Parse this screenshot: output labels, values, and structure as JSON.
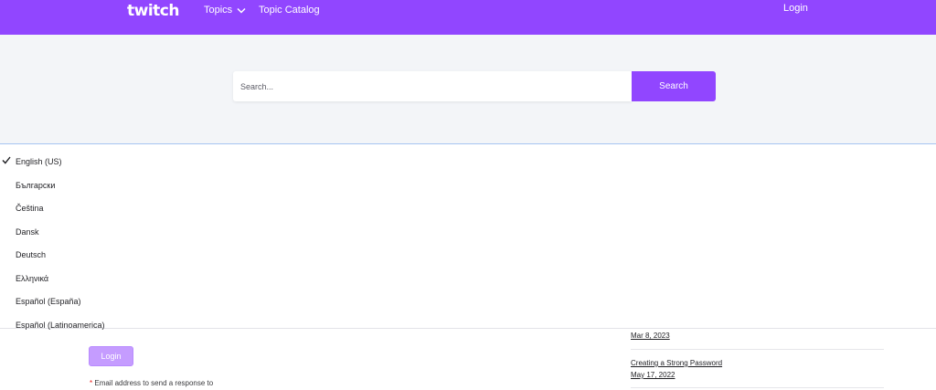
{
  "header": {
    "logo_text": "twitch",
    "topics_label": "Topics",
    "catalog_label": "Topic Catalog",
    "login_label": "Login"
  },
  "search": {
    "placeholder": "Search...",
    "button_label": "Search"
  },
  "language_menu": {
    "selected": "English (US)",
    "items": [
      "English (US)",
      "Български",
      "Čeština",
      "Dansk",
      "Deutsch",
      "Ελληνικά",
      "Español (España)",
      "Español (Latinoamerica)"
    ]
  },
  "form": {
    "login_button": "Login",
    "required_mark": "*",
    "email_note": "Email address to send a response to"
  },
  "articles": {
    "first_date": "Mar 8, 2023",
    "second_title": "Creating a Strong Password",
    "second_date": "May 17, 2022"
  },
  "colors": {
    "brand": "#9146ff",
    "band_bg": "#f3f5f8",
    "login_disabled": "#c59cff"
  }
}
